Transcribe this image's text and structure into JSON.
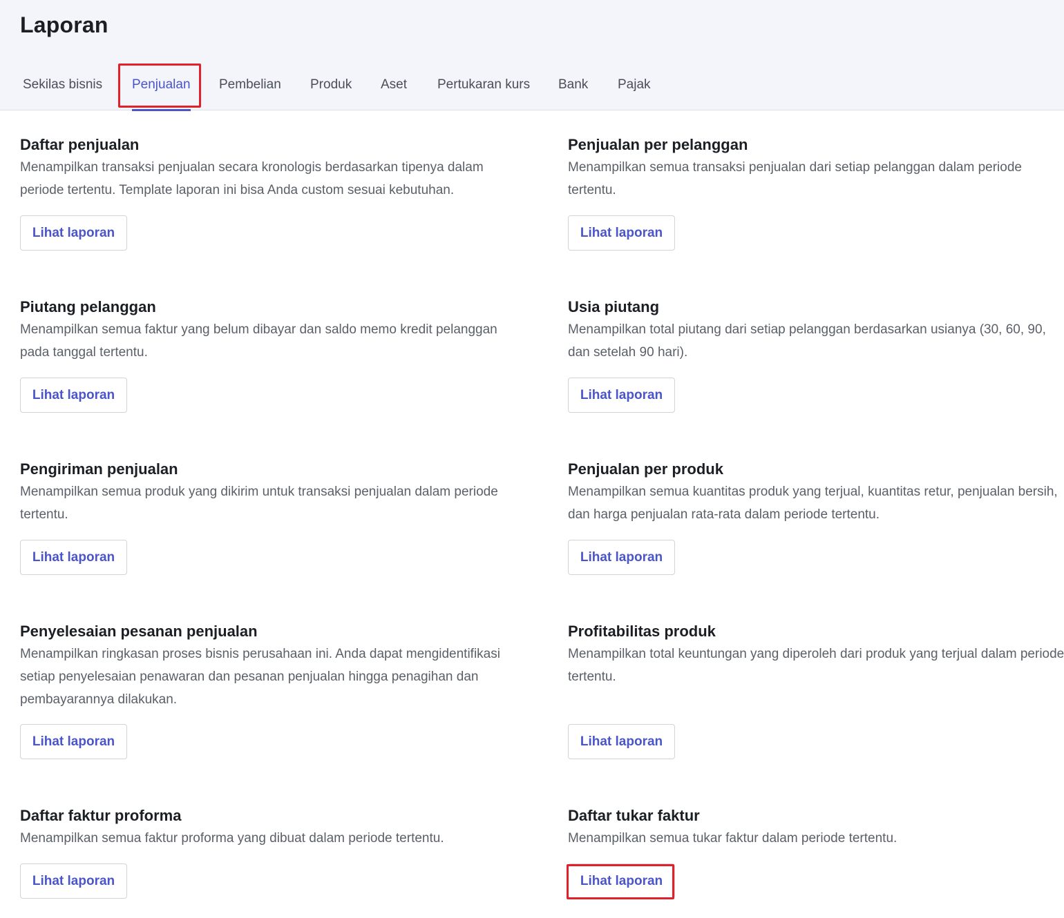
{
  "header": {
    "title": "Laporan"
  },
  "tabs": [
    {
      "label": "Sekilas bisnis",
      "active": false
    },
    {
      "label": "Penjualan",
      "active": true
    },
    {
      "label": "Pembelian",
      "active": false
    },
    {
      "label": "Produk",
      "active": false
    },
    {
      "label": "Aset",
      "active": false
    },
    {
      "label": "Pertukaran kurs",
      "active": false
    },
    {
      "label": "Bank",
      "active": false
    },
    {
      "label": "Pajak",
      "active": false
    }
  ],
  "reports": [
    {
      "title": "Daftar penjualan",
      "description": "Menampilkan transaksi penjualan secara kronologis berdasarkan tipenya dalam periode tertentu. Template laporan ini bisa Anda custom sesuai kebutuhan.",
      "button": "Lihat laporan"
    },
    {
      "title": "Penjualan per pelanggan",
      "description": "Menampilkan semua transaksi penjualan dari setiap pelanggan dalam periode tertentu.",
      "button": "Lihat laporan"
    },
    {
      "title": "Piutang pelanggan",
      "description": "Menampilkan semua faktur yang belum dibayar dan saldo memo kredit pelanggan pada tanggal tertentu.",
      "button": "Lihat laporan"
    },
    {
      "title": "Usia piutang",
      "description": "Menampilkan total piutang dari setiap pelanggan berdasarkan usianya (30, 60, 90, dan setelah 90 hari).",
      "button": "Lihat laporan"
    },
    {
      "title": "Pengiriman penjualan",
      "description": "Menampilkan semua produk yang dikirim untuk transaksi penjualan dalam periode tertentu.",
      "button": "Lihat laporan"
    },
    {
      "title": "Penjualan per produk",
      "description": "Menampilkan semua kuantitas produk yang terjual, kuantitas retur, penjualan bersih, dan harga penjualan rata-rata dalam periode tertentu.",
      "button": "Lihat laporan"
    },
    {
      "title": "Penyelesaian pesanan penjualan",
      "description": "Menampilkan ringkasan proses bisnis perusahaan ini. Anda dapat mengidentifikasi setiap penyelesaian penawaran dan pesanan penjualan hingga penagihan dan pembayarannya dilakukan.",
      "button": "Lihat laporan"
    },
    {
      "title": "Profitabilitas produk",
      "description": "Menampilkan total keuntungan yang diperoleh dari produk yang terjual dalam periode tertentu.",
      "button": "Lihat laporan"
    },
    {
      "title": "Daftar faktur proforma",
      "description": "Menampilkan semua faktur proforma yang dibuat dalam periode tertentu.",
      "button": "Lihat laporan"
    },
    {
      "title": "Daftar tukar faktur",
      "description": "Menampilkan semua tukar faktur dalam periode tertentu.",
      "button": "Lihat laporan"
    }
  ],
  "colors": {
    "accent": "#4a55c9",
    "highlight": "#e0202a",
    "header_bg": "#f3f5fa"
  }
}
